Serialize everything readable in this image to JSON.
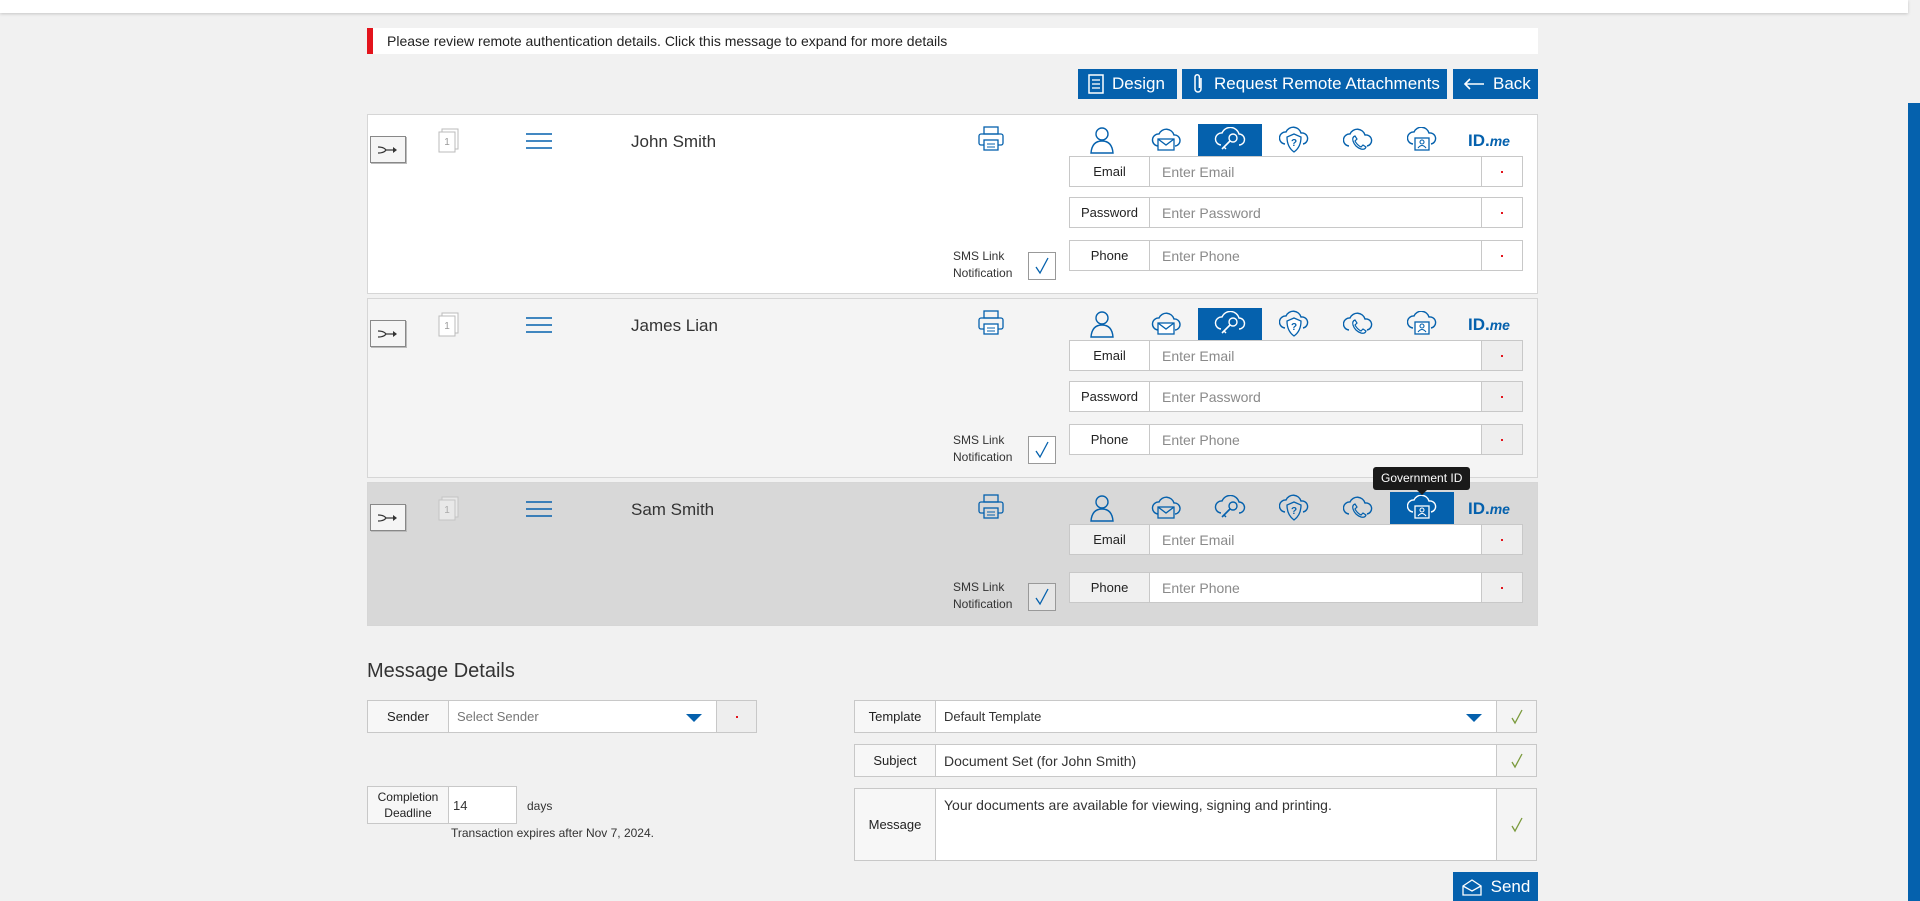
{
  "notice": {
    "text": "Please review remote authentication details. Click this message to expand for more details"
  },
  "toolbar": {
    "design_label": "Design",
    "attach_label": "Request Remote Attachments",
    "back_label": "Back"
  },
  "auth_methods": [
    "user-icon",
    "cloud-email-icon",
    "cloud-key-icon",
    "shield-question-icon",
    "cloud-phone-icon",
    "government-id-icon",
    "idme-logo"
  ],
  "idme": {
    "main": "ID.",
    "suffix": "me"
  },
  "signers": [
    {
      "name": "John Smith",
      "doc_count": "1",
      "active_method": "cloud-key-icon",
      "fields": [
        {
          "label": "Email",
          "placeholder": "Enter Email"
        },
        {
          "label": "Password",
          "placeholder": "Enter Password"
        },
        {
          "label": "Phone",
          "placeholder": "Enter Phone"
        }
      ],
      "sms": {
        "line1": "SMS Link",
        "line2": "Notification",
        "checked": true
      }
    },
    {
      "name": "James Lian",
      "doc_count": "1",
      "active_method": "cloud-key-icon",
      "fields": [
        {
          "label": "Email",
          "placeholder": "Enter Email"
        },
        {
          "label": "Password",
          "placeholder": "Enter Password"
        },
        {
          "label": "Phone",
          "placeholder": "Enter Phone"
        }
      ],
      "sms": {
        "line1": "SMS Link",
        "line2": "Notification",
        "checked": true
      }
    },
    {
      "name": "Sam Smith",
      "doc_count": "1",
      "active_method": "government-id-icon",
      "fields": [
        {
          "label": "Email",
          "placeholder": "Enter Email"
        },
        {
          "label": "Phone",
          "placeholder": "Enter Phone"
        }
      ],
      "sms": {
        "line1": "SMS Link",
        "line2": "Notification",
        "checked": true
      }
    }
  ],
  "tooltip": {
    "text": "Government ID"
  },
  "message_details": {
    "title": "Message Details",
    "sender": {
      "label": "Sender",
      "placeholder": "Select Sender"
    },
    "deadline": {
      "label_line1": "Completion",
      "label_line2": "Deadline",
      "value": "14",
      "unit": "days",
      "expiry_note": "Transaction expires after Nov 7, 2024."
    },
    "template": {
      "label": "Template",
      "value": "Default Template"
    },
    "subject": {
      "label": "Subject",
      "value": "Document Set (for John Smith)"
    },
    "message": {
      "label": "Message",
      "value": "Your documents are available for viewing, signing and printing."
    },
    "send_label": "Send"
  },
  "colors": {
    "accent": "#0561ad",
    "alert": "#e3141c",
    "check": "#7a9a3c"
  }
}
